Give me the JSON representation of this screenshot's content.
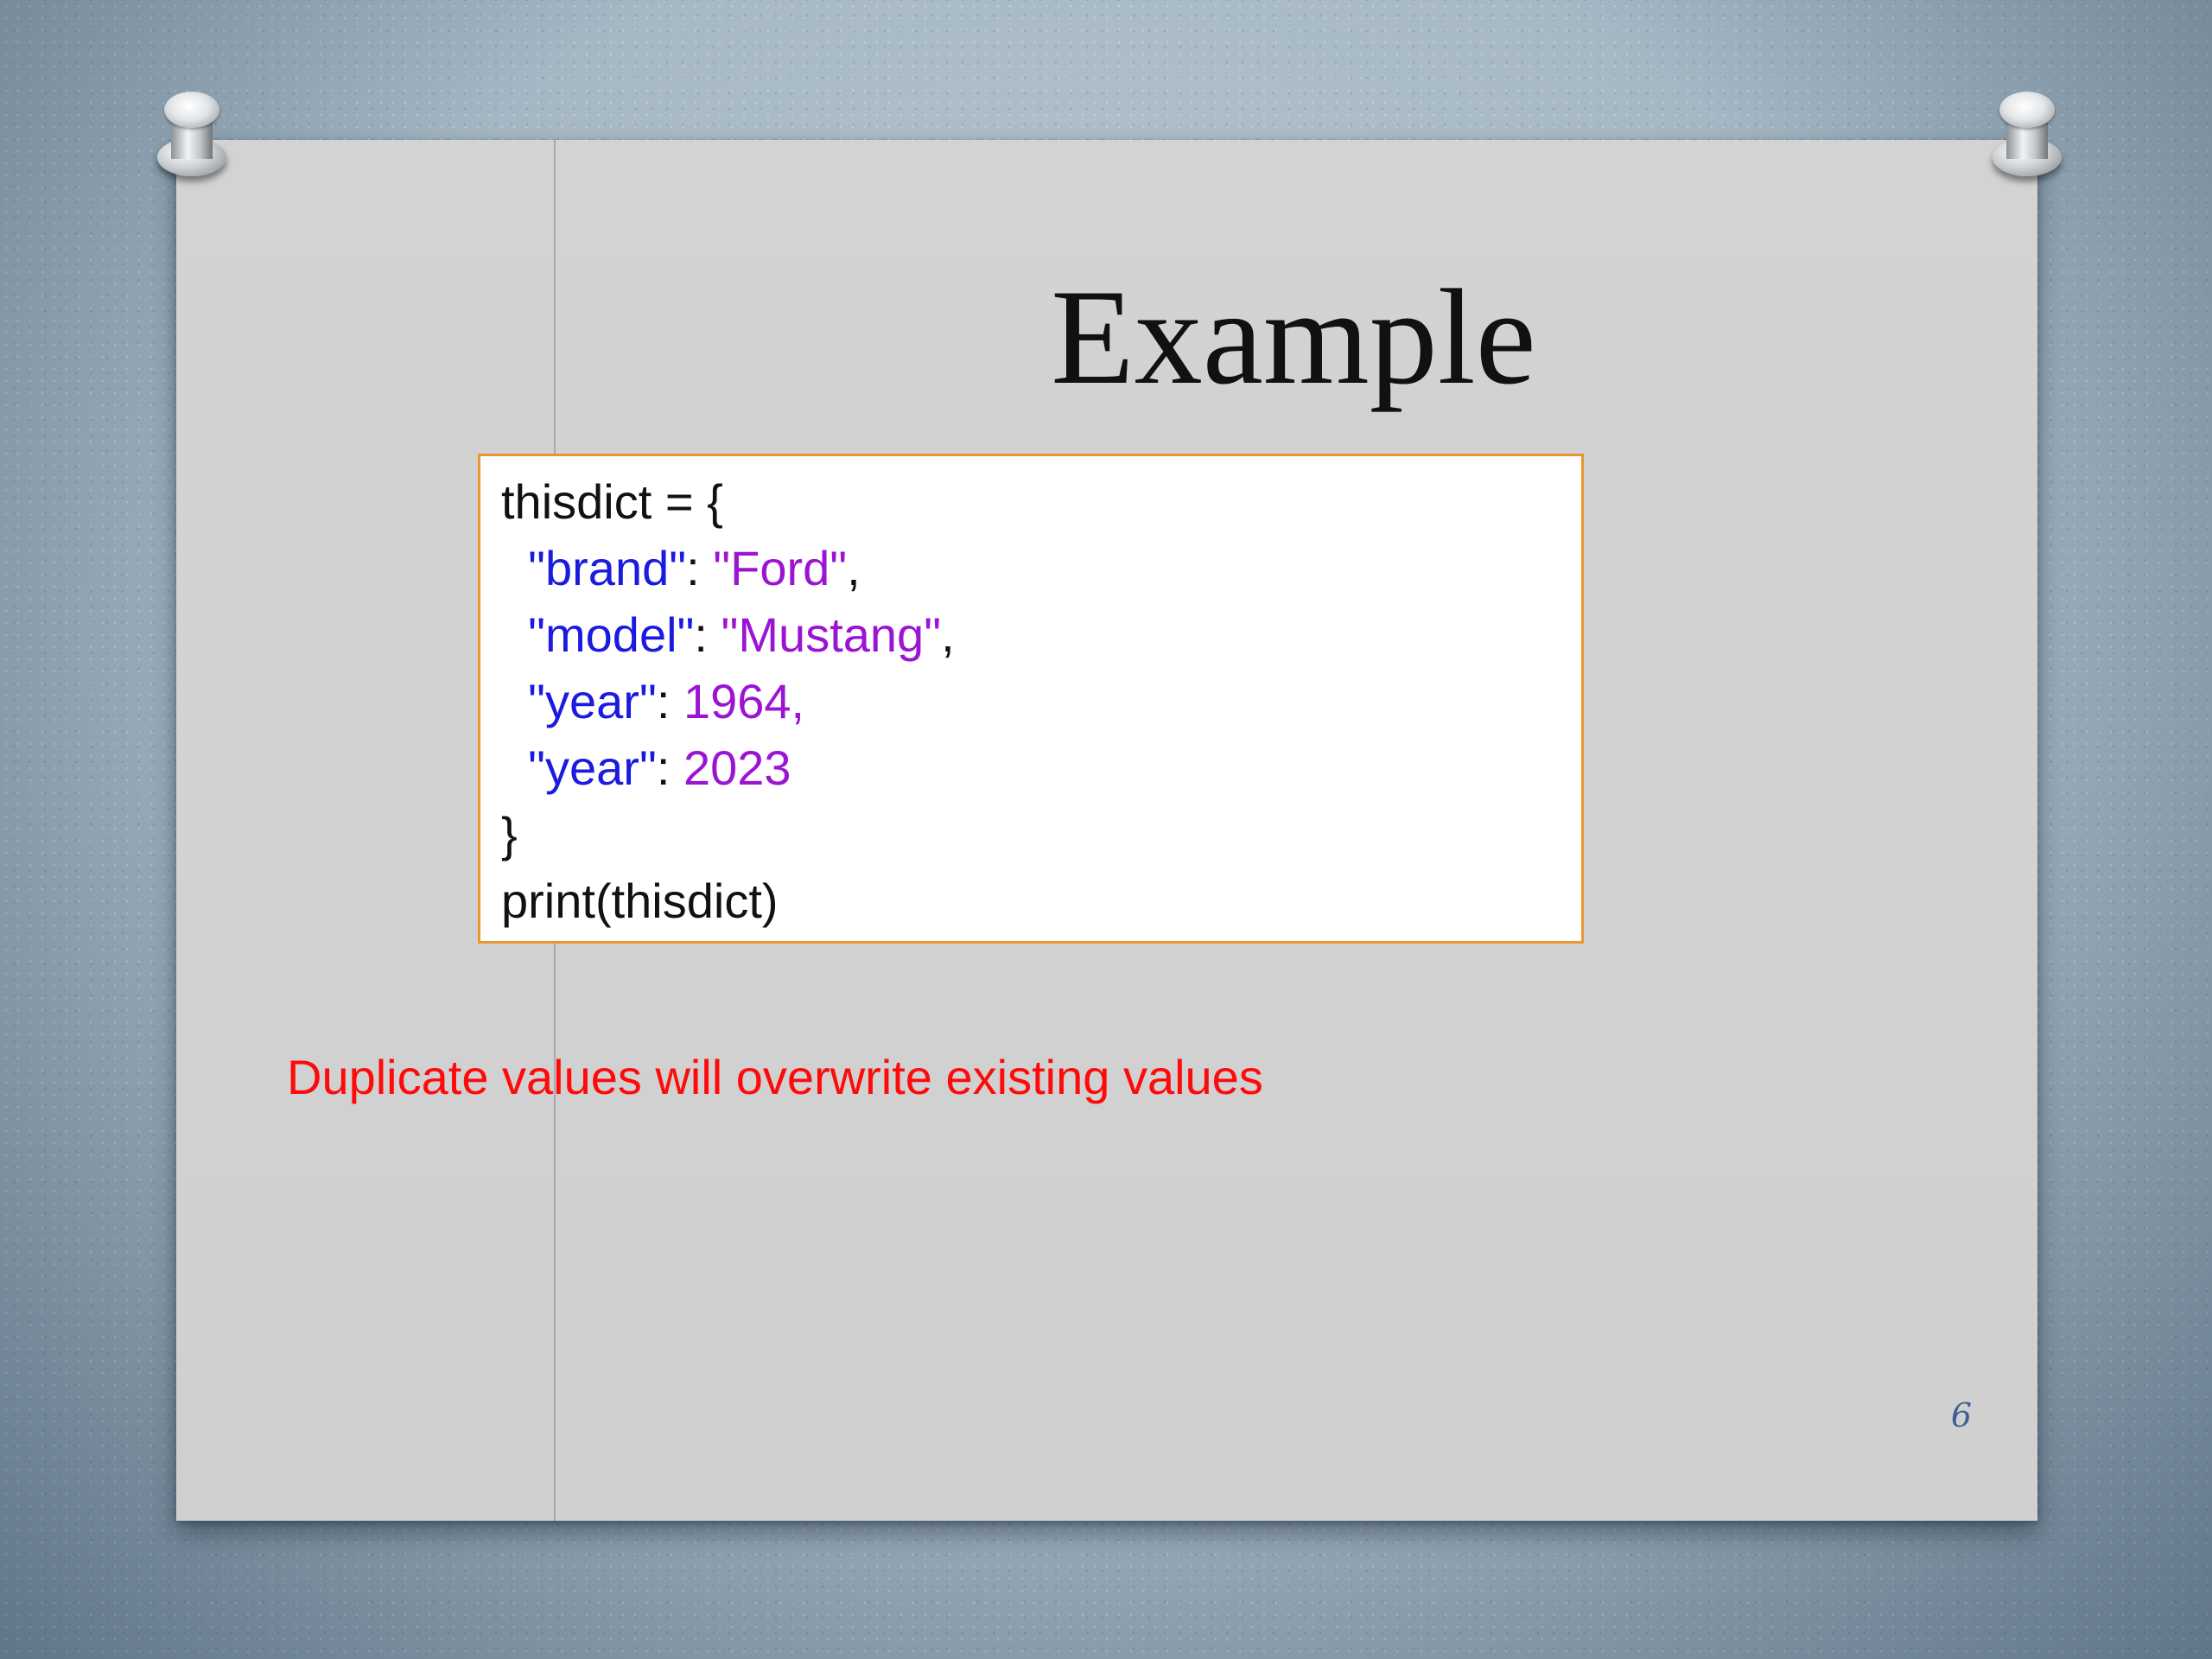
{
  "slide": {
    "title": "Example",
    "code_lines": [
      [
        {
          "t": "thisdict = {",
          "k": "plain"
        }
      ],
      [
        {
          "t": "  ",
          "k": "plain"
        },
        {
          "t": "\"brand\"",
          "k": "key"
        },
        {
          "t": ": ",
          "k": "plain"
        },
        {
          "t": "\"Ford\"",
          "k": "val"
        },
        {
          "t": ",",
          "k": "plain"
        }
      ],
      [
        {
          "t": "  ",
          "k": "plain"
        },
        {
          "t": "\"model\"",
          "k": "key"
        },
        {
          "t": ": ",
          "k": "plain"
        },
        {
          "t": "\"Mustang\"",
          "k": "val"
        },
        {
          "t": ",",
          "k": "plain"
        }
      ],
      [
        {
          "t": "  ",
          "k": "plain"
        },
        {
          "t": "\"year\"",
          "k": "key"
        },
        {
          "t": ": ",
          "k": "plain"
        },
        {
          "t": "1964,",
          "k": "val"
        }
      ],
      [
        {
          "t": "  ",
          "k": "plain"
        },
        {
          "t": "\"year\"",
          "k": "key"
        },
        {
          "t": ": ",
          "k": "plain"
        },
        {
          "t": "2023",
          "k": "val"
        }
      ],
      [
        {
          "t": "}",
          "k": "plain"
        }
      ],
      [
        {
          "t": "print(thisdict)",
          "k": "plain"
        }
      ]
    ],
    "note": "Duplicate values will overwrite existing values",
    "page_number": "6"
  },
  "colors": {
    "code_key": "#1a1ae0",
    "code_value": "#9b14d4",
    "note": "#ff0a0a",
    "code_border": "#e8962e",
    "page_number": "#3d5f94"
  }
}
